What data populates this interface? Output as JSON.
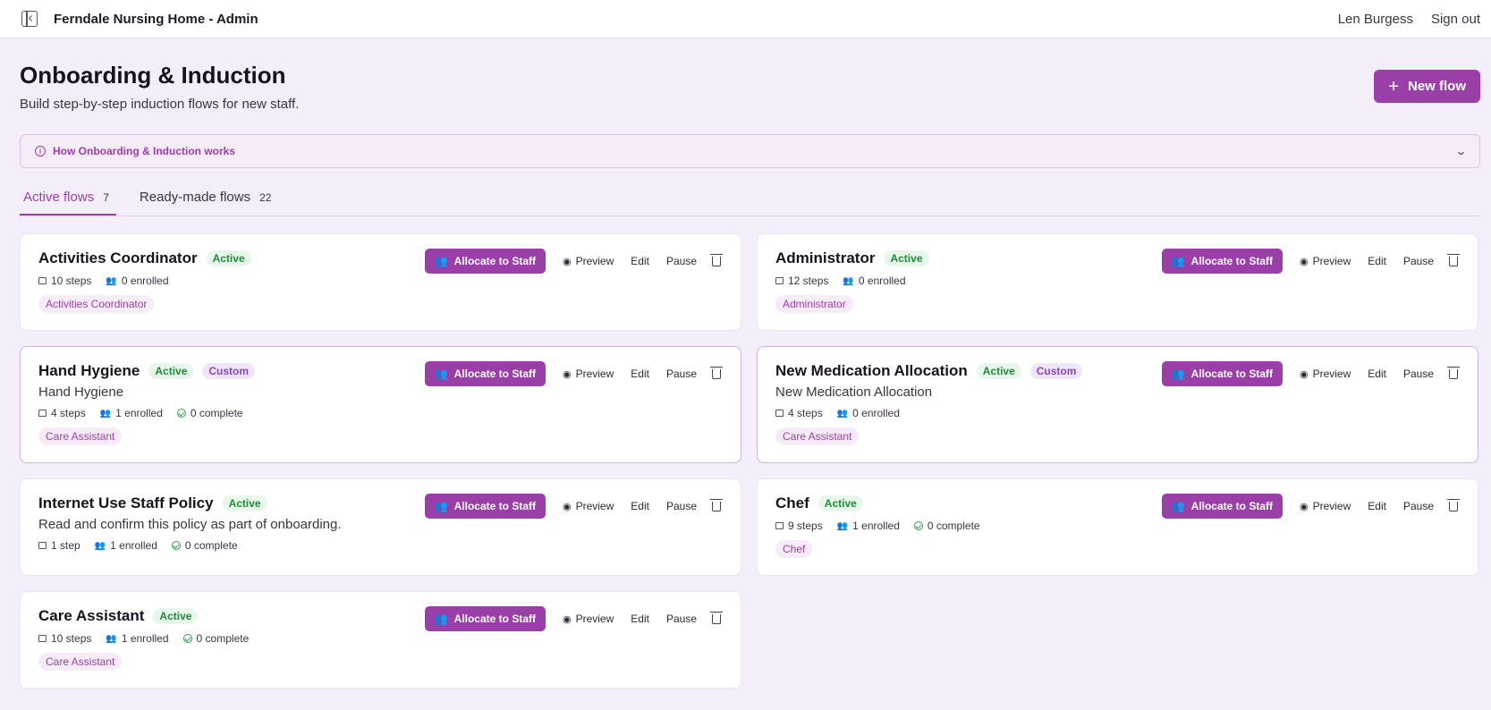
{
  "header": {
    "app_title": "Ferndale Nursing Home - Admin",
    "user_name": "Len Burgess",
    "sign_out": "Sign out"
  },
  "page": {
    "title": "Onboarding & Induction",
    "subtitle": "Build step-by-step induction flows for new staff.",
    "new_flow_label": "New flow",
    "info_label": "How Onboarding & Induction works"
  },
  "tabs": [
    {
      "label": "Active flows",
      "count": "7"
    },
    {
      "label": "Ready-made flows",
      "count": "22"
    }
  ],
  "actions": {
    "allocate": "Allocate to Staff",
    "preview": "Preview",
    "edit": "Edit",
    "pause": "Pause"
  },
  "flows": [
    {
      "title": "Activities Coordinator",
      "status": "Active",
      "steps": "10 steps",
      "enrolled": "0 enrolled",
      "tag": "Activities Coordinator"
    },
    {
      "title": "Administrator",
      "status": "Active",
      "steps": "12 steps",
      "enrolled": "0 enrolled",
      "tag": "Administrator"
    },
    {
      "title": "Hand Hygiene",
      "status": "Active",
      "custom": "Custom",
      "description": "Hand Hygiene",
      "steps": "4 steps",
      "enrolled": "1 enrolled",
      "complete": "0 complete",
      "tag": "Care Assistant"
    },
    {
      "title": "New Medication Allocation",
      "status": "Active",
      "custom": "Custom",
      "description": "New Medication Allocation",
      "steps": "4 steps",
      "enrolled": "0 enrolled",
      "tag": "Care Assistant"
    },
    {
      "title": "Internet Use Staff Policy",
      "status": "Active",
      "description": "Read and confirm this policy as part of onboarding.",
      "steps": "1 step",
      "enrolled": "1 enrolled",
      "complete": "0 complete"
    },
    {
      "title": "Chef",
      "status": "Active",
      "steps": "9 steps",
      "enrolled": "1 enrolled",
      "complete": "0 complete",
      "tag": "Chef"
    },
    {
      "title": "Care Assistant",
      "status": "Active",
      "steps": "10 steps",
      "enrolled": "1 enrolled",
      "complete": "0 complete",
      "tag": "Care Assistant"
    }
  ]
}
